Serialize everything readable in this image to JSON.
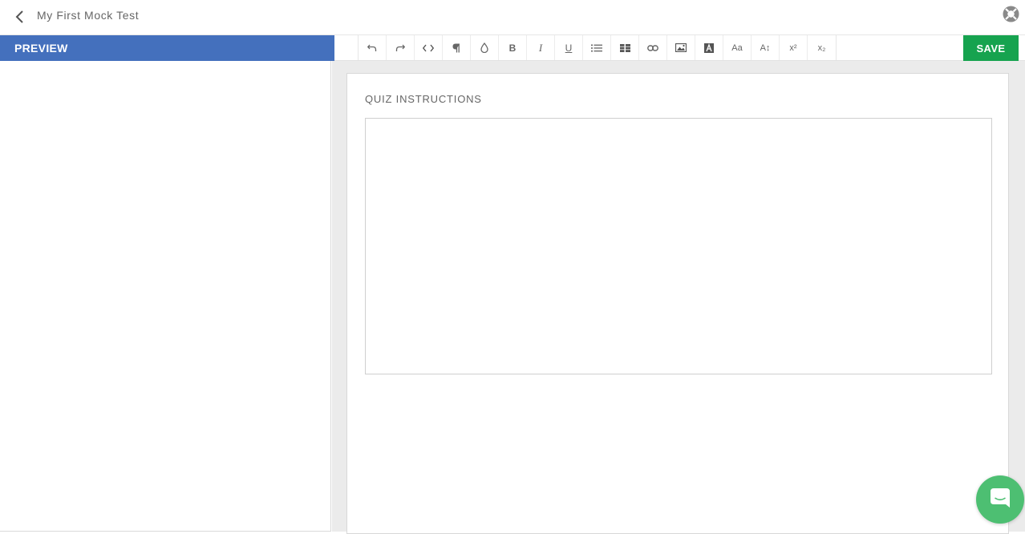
{
  "header": {
    "title": "My First Mock Test"
  },
  "preview": {
    "label": "PREVIEW"
  },
  "toolbar": {
    "tools": [
      {
        "name": "undo-icon"
      },
      {
        "name": "redo-icon"
      },
      {
        "name": "code-view-icon"
      },
      {
        "name": "paragraph-icon"
      },
      {
        "name": "color-drop-icon"
      },
      {
        "name": "bold-icon",
        "text": "B"
      },
      {
        "name": "italic-icon",
        "text": "I"
      },
      {
        "name": "underline-icon",
        "text": "U"
      },
      {
        "name": "bullet-list-icon"
      },
      {
        "name": "table-icon"
      },
      {
        "name": "link-icon"
      },
      {
        "name": "image-icon"
      },
      {
        "name": "text-color-icon"
      },
      {
        "name": "font-family-icon",
        "text": "Aa"
      },
      {
        "name": "font-size-icon",
        "text": "A↕"
      },
      {
        "name": "superscript-icon",
        "text": "x²"
      },
      {
        "name": "subscript-icon",
        "text": "x₂"
      }
    ],
    "save_label": "SAVE"
  },
  "editor": {
    "section_label": "QUIZ INSTRUCTIONS",
    "instructions_value": ""
  },
  "colors": {
    "preview_bar": "#4470bd",
    "save_button": "#16a34f",
    "chat_button": "#4dbf72"
  }
}
